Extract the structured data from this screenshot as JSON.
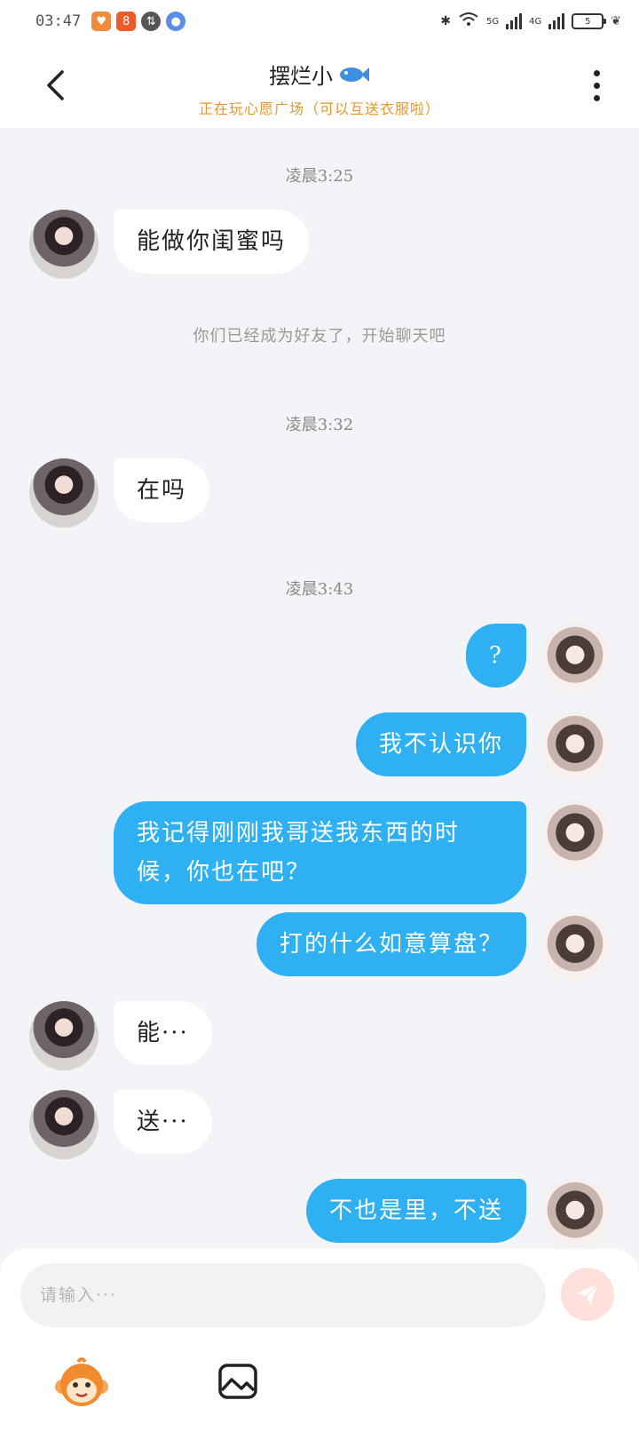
{
  "status_bar": {
    "time": "03:47",
    "network_1": "5G",
    "network_2": "4G",
    "battery": "5"
  },
  "header": {
    "title": "摆烂小",
    "title_icon": "fish-icon",
    "subtitle": "正在玩心愿广场（可以互送衣服啦）"
  },
  "messages": [
    {
      "type": "time",
      "text": "凌晨3:25"
    },
    {
      "type": "incoming",
      "text": "能做你闺蜜吗"
    },
    {
      "type": "system",
      "text": "你们已经成为好友了，开始聊天吧"
    },
    {
      "type": "time",
      "text": "凌晨3:32"
    },
    {
      "type": "incoming",
      "text": "在吗"
    },
    {
      "type": "time",
      "text": "凌晨3:43"
    },
    {
      "type": "outgoing",
      "text": "?"
    },
    {
      "type": "outgoing",
      "text": "我不认识你"
    },
    {
      "type": "outgoing",
      "text": "我记得刚刚我哥送我东西的时候，你也在吧？"
    },
    {
      "type": "outgoing",
      "text": "打的什么如意算盘？"
    },
    {
      "type": "incoming",
      "text": "能···"
    },
    {
      "type": "incoming",
      "text": "送···"
    },
    {
      "type": "outgoing",
      "text": "不也是里，不送"
    }
  ],
  "input": {
    "placeholder": "请输入···",
    "value": ""
  },
  "colors": {
    "outgoing_bubble": "#2fb0f2",
    "incoming_bubble": "#ffffff",
    "subtitle": "#e8962b",
    "send_button": "#ffe0dd"
  }
}
